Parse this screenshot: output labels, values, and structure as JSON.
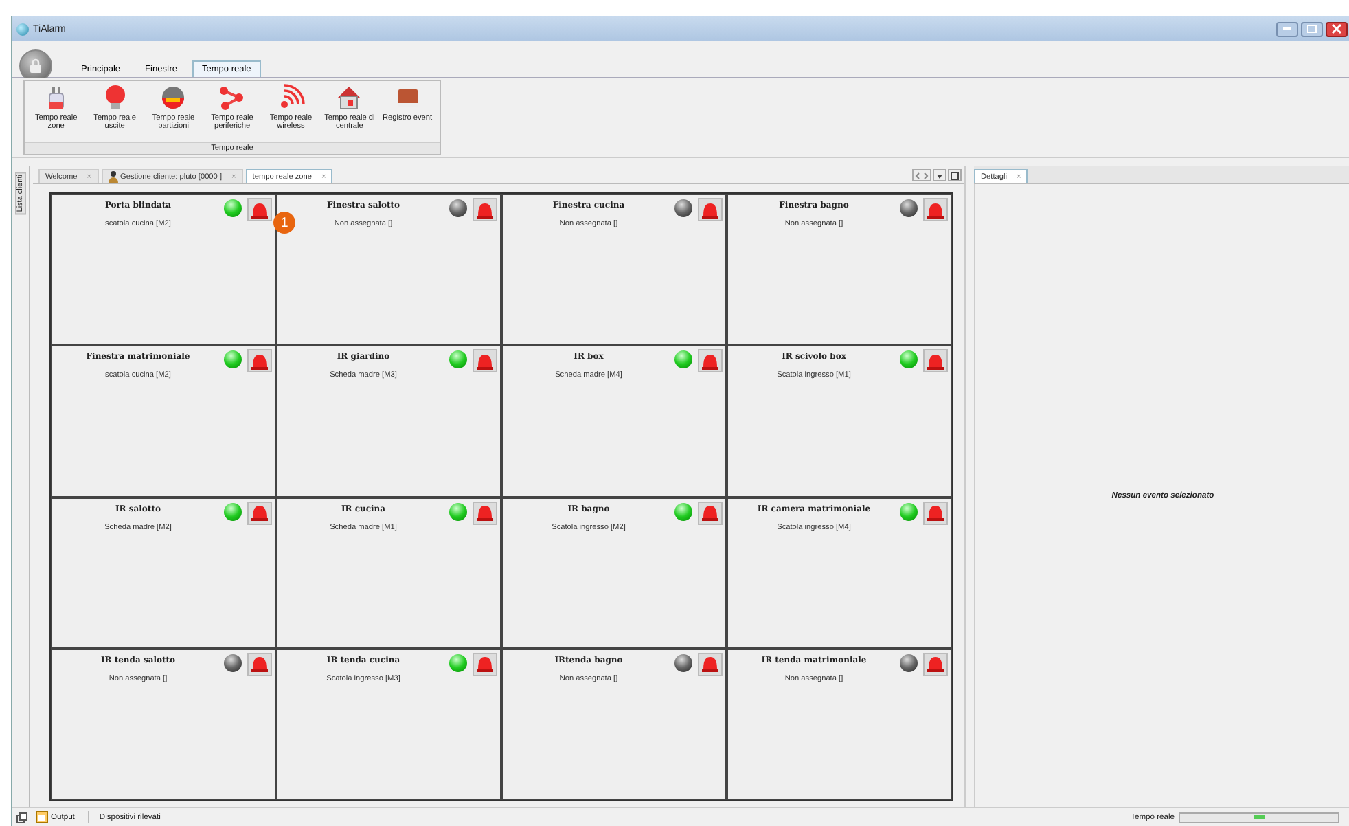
{
  "window": {
    "title": "TiAlarm"
  },
  "ribbon": {
    "tabs": [
      {
        "label": "Principale",
        "selected": false
      },
      {
        "label": "Finestre",
        "selected": false
      },
      {
        "label": "Tempo reale",
        "selected": true
      }
    ],
    "buttons": [
      {
        "kind": "zones",
        "label": "Tempo reale zone"
      },
      {
        "kind": "outputs",
        "label": "Tempo reale uscite"
      },
      {
        "kind": "partitions",
        "label": "Tempo reale partizioni"
      },
      {
        "kind": "peripherals",
        "label": "Tempo reale periferiche"
      },
      {
        "kind": "wireless",
        "label": "Tempo reale wireless"
      },
      {
        "kind": "central",
        "label": "Tempo reale di centrale"
      },
      {
        "kind": "log",
        "label": "Registro eventi"
      }
    ],
    "group_label": "Tempo reale"
  },
  "side_strip": {
    "label": "Lista clienti"
  },
  "doc_tabs": [
    {
      "label": "Welcome",
      "close": "×",
      "selected": false,
      "icon": false
    },
    {
      "label": "Gestione cliente: pluto [0000 ]",
      "close": "×",
      "selected": false,
      "icon": true
    },
    {
      "label": "tempo reale zone",
      "close": "×",
      "selected": true,
      "icon": false
    }
  ],
  "zones": [
    {
      "name": "Porta blindata",
      "location": "scatola cucina [M2]",
      "active": true
    },
    {
      "name": "Finestra salotto",
      "location": "Non assegnata []",
      "active": false
    },
    {
      "name": "Finestra cucina",
      "location": "Non assegnata []",
      "active": false
    },
    {
      "name": "Finestra bagno",
      "location": "Non assegnata []",
      "active": false
    },
    {
      "name": "Finestra matrimoniale",
      "location": "scatola cucina [M2]",
      "active": true
    },
    {
      "name": "IR giardino",
      "location": "Scheda madre [M3]",
      "active": true
    },
    {
      "name": "IR box",
      "location": "Scheda madre [M4]",
      "active": true
    },
    {
      "name": "IR scivolo box",
      "location": "Scatola ingresso [M1]",
      "active": true
    },
    {
      "name": "IR salotto",
      "location": "Scheda madre [M2]",
      "active": true
    },
    {
      "name": "IR cucina",
      "location": "Scheda madre [M1]",
      "active": true
    },
    {
      "name": "IR bagno",
      "location": "Scatola ingresso [M2]",
      "active": true
    },
    {
      "name": "IR camera matrimoniale",
      "location": "Scatola ingresso [M4]",
      "active": true
    },
    {
      "name": "IR tenda salotto",
      "location": "Non assegnata []",
      "active": false
    },
    {
      "name": "IR tenda cucina",
      "location": "Scatola ingresso [M3]",
      "active": true
    },
    {
      "name": "IRtenda bagno",
      "location": "Non assegnata []",
      "active": false
    },
    {
      "name": "IR tenda matrimoniale",
      "location": "Non assegnata []",
      "active": false
    }
  ],
  "callout": {
    "label": "1"
  },
  "details_panel": {
    "tab": "Dettagli",
    "tab_close": "×",
    "empty_message": "Nessun evento selezionato"
  },
  "status_bar": {
    "output": "Output",
    "message": "Dispositivi rilevati",
    "mode": "Tempo reale"
  }
}
